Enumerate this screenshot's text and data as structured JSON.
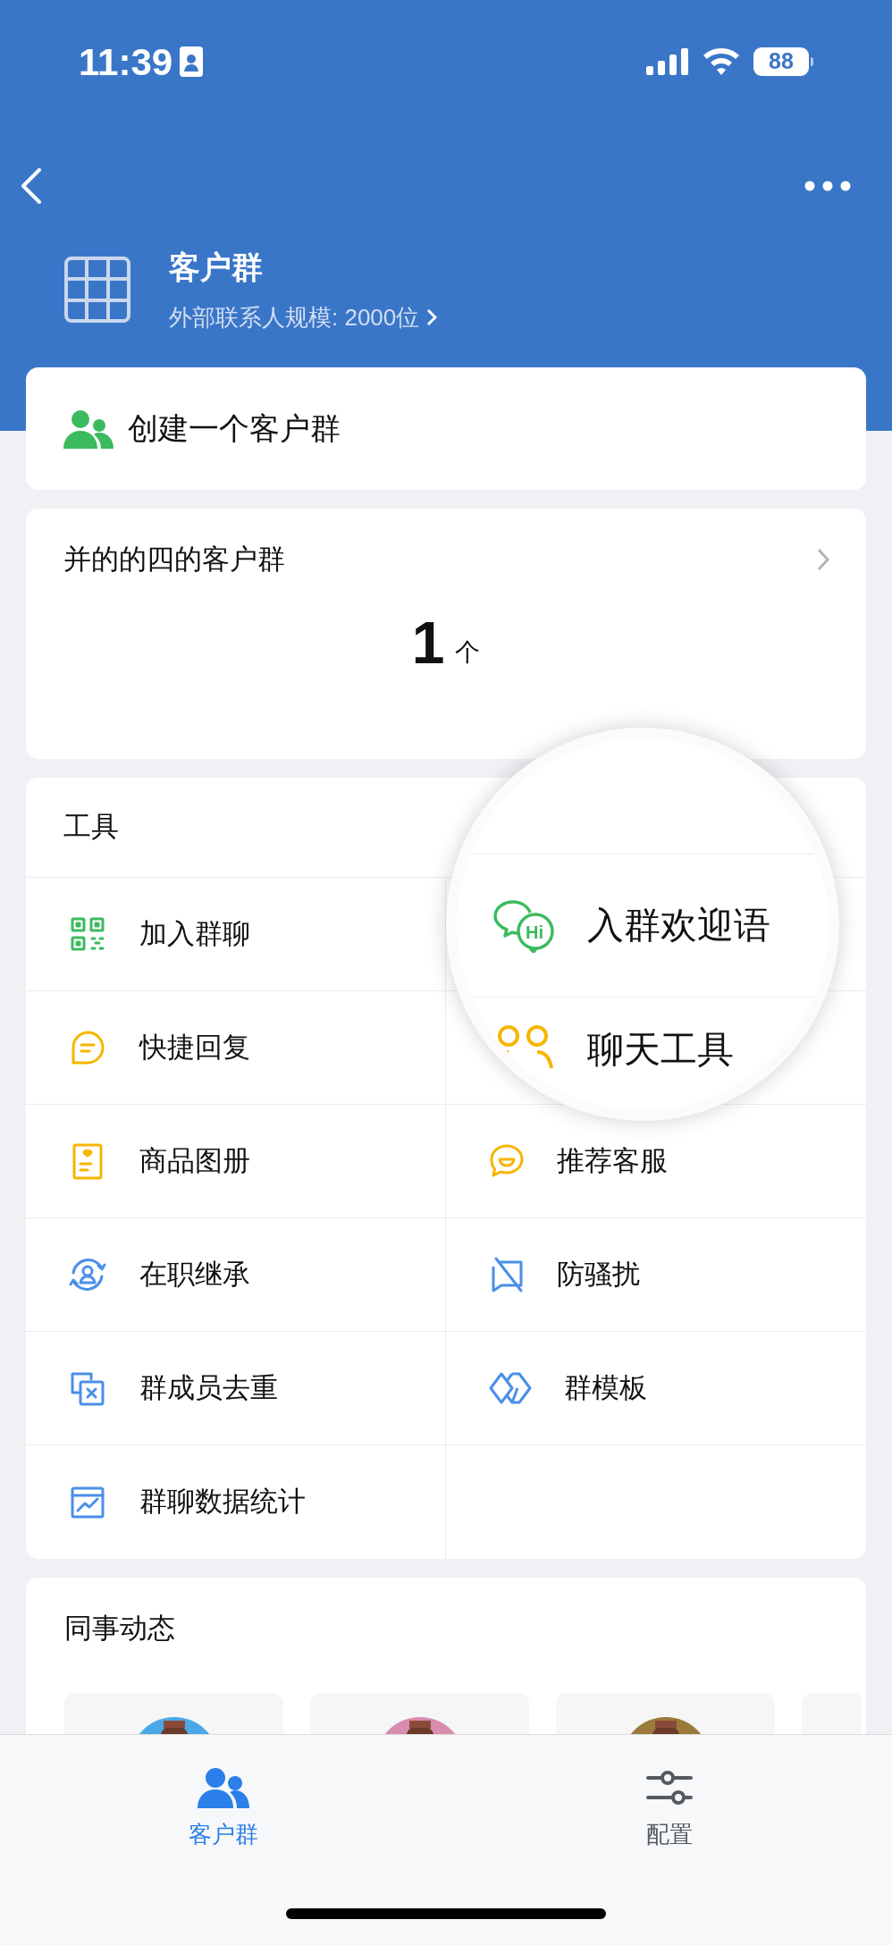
{
  "status_bar": {
    "time": "11:39",
    "battery": "88"
  },
  "header": {
    "title": "客户群",
    "subtitle": "外部联系人规模: 2000位"
  },
  "create_card": {
    "label": "创建一个客户群"
  },
  "summary_card": {
    "title": "并的的四的客户群",
    "count": "1",
    "unit": "个"
  },
  "tools": {
    "title": "工具",
    "rows": [
      {
        "left": {
          "label": "加入群聊"
        }
      },
      {
        "left": {
          "label": "快捷回复"
        }
      },
      {
        "left": {
          "label": "商品图册"
        },
        "right": {
          "label": "推荐客服"
        }
      },
      {
        "left": {
          "label": "在职继承"
        },
        "right": {
          "label": "防骚扰"
        }
      },
      {
        "left": {
          "label": "群成员去重"
        },
        "right": {
          "label": "群模板"
        }
      },
      {
        "left": {
          "label": "群聊数据统计"
        }
      }
    ]
  },
  "magnifier": {
    "icon_text": "Hi",
    "items": [
      "入群欢迎语",
      "聊天工具"
    ]
  },
  "colleague_feed": {
    "title": "同事动态",
    "cards": [
      {
        "kind": "picture"
      },
      {
        "kind": "picture"
      },
      {
        "kind": "picture"
      },
      {
        "kind": "empty"
      }
    ]
  },
  "tab_bar": [
    {
      "label": "客户群",
      "selected": true
    },
    {
      "label": "配置",
      "selected": false
    }
  ]
}
